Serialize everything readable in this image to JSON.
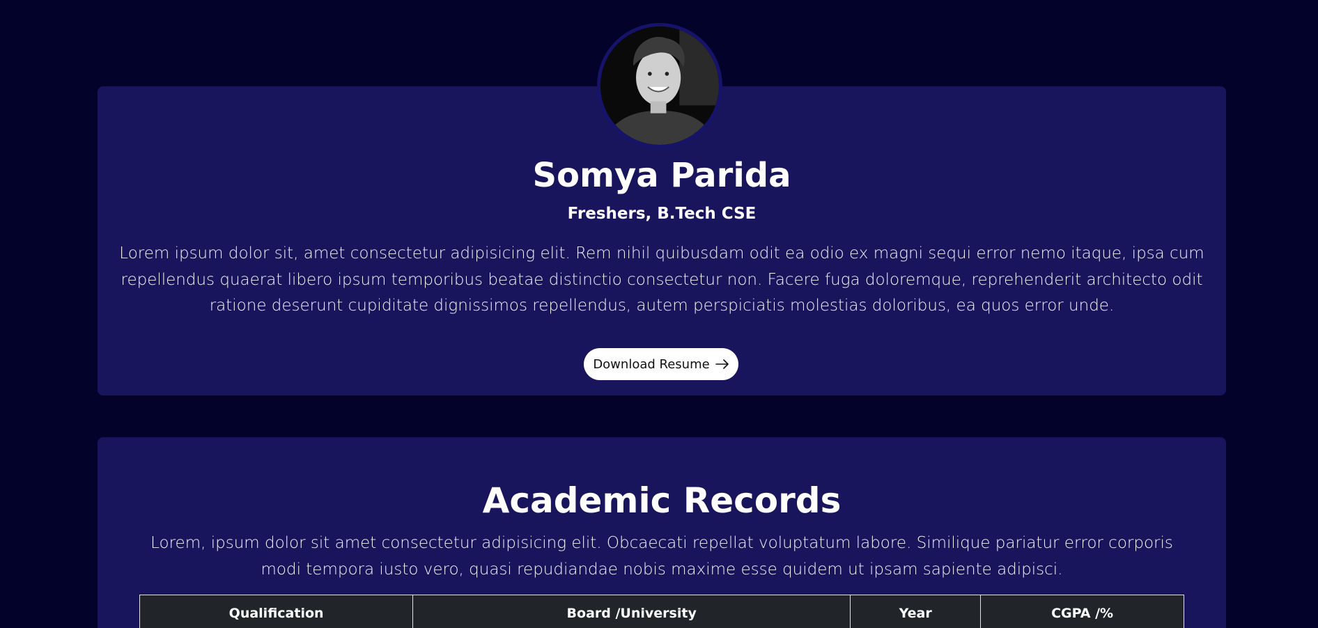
{
  "profile": {
    "avatar_icon": "profile-photo",
    "name": "Somya Parida",
    "role": "Freshers, B.Tech CSE",
    "bio": "Lorem ipsum dolor sit, amet consectetur adipisicing elit. Rem nihil quibusdam odit ea odio ex magni sequi error nemo itaque, ipsa cum repellendus quaerat libero ipsum temporibus beatae distinctio consectetur non. Facere fuga doloremque, reprehenderit architecto odit ratione deserunt cupiditate dignissimos repellendus, autem perspiciatis molestias doloribus, ea quos error unde.",
    "download_label": "Download Resume",
    "download_icon": "arrow-right-icon"
  },
  "academics": {
    "title": "Academic Records",
    "description": "Lorem, ipsum dolor sit amet consectetur adipisicing elit. Obcaecati repellat voluptatum labore. Similique pariatur error corporis modi tempora iusto vero, quasi repudiandae nobis maxime esse quidem ut ipsam sapiente adipisci.",
    "table_headers": [
      "Qualification",
      "Board /University",
      "Year",
      "CGPA /%"
    ]
  },
  "colors": {
    "page_background": "#03022b",
    "card_background": "#18155c",
    "table_header_background": "#212529",
    "button_background": "#ffffff"
  }
}
